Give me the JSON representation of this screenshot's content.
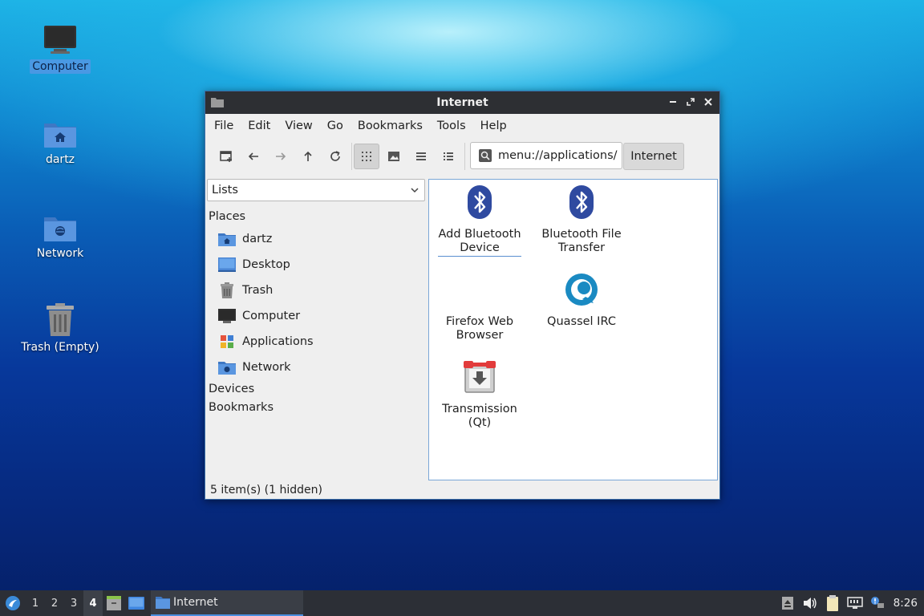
{
  "desktop": {
    "icons": [
      {
        "label": "Computer"
      },
      {
        "label": "dartz"
      },
      {
        "label": "Network"
      },
      {
        "label": "Trash (Empty)"
      }
    ]
  },
  "window": {
    "title": "Internet",
    "menu": [
      "File",
      "Edit",
      "View",
      "Go",
      "Bookmarks",
      "Tools",
      "Help"
    ],
    "path": "menu://applications/",
    "breadcrumb": "Internet",
    "sidebar_mode": "Lists",
    "places_header": "Places",
    "places": [
      {
        "label": "dartz",
        "icon": "home-folder-icon"
      },
      {
        "label": "Desktop",
        "icon": "desktop-icon"
      },
      {
        "label": "Trash",
        "icon": "trash-icon"
      },
      {
        "label": "Computer",
        "icon": "computer-icon"
      },
      {
        "label": "Applications",
        "icon": "applications-icon"
      },
      {
        "label": "Network",
        "icon": "network-icon"
      }
    ],
    "devices_header": "Devices",
    "bookmarks_header": "Bookmarks",
    "items": [
      {
        "line1": "Add Bluetooth",
        "line2": "Device",
        "icon": "bluetooth-icon"
      },
      {
        "line1": "Bluetooth File",
        "line2": "Transfer",
        "icon": "bluetooth-icon"
      },
      {
        "line1": "Firefox Web",
        "line2": "Browser",
        "icon": "none"
      },
      {
        "line1": "Quassel IRC",
        "line2": "",
        "icon": "quassel-icon"
      },
      {
        "line1": "Transmission",
        "line2": "(Qt)",
        "icon": "transmission-icon"
      }
    ],
    "status": "5 item(s) (1 hidden)"
  },
  "taskbar": {
    "desktops": [
      "1",
      "2",
      "3",
      "4"
    ],
    "active_desktop": "4",
    "task_label": "Internet",
    "clock": "8:26"
  },
  "colors": {
    "accent": "#4a8fe0",
    "folder_blue": "#4a86d4",
    "bluetooth": "#2f4aa0",
    "taskbar": "#2c2f36",
    "titlebar": "#2d2f33"
  }
}
